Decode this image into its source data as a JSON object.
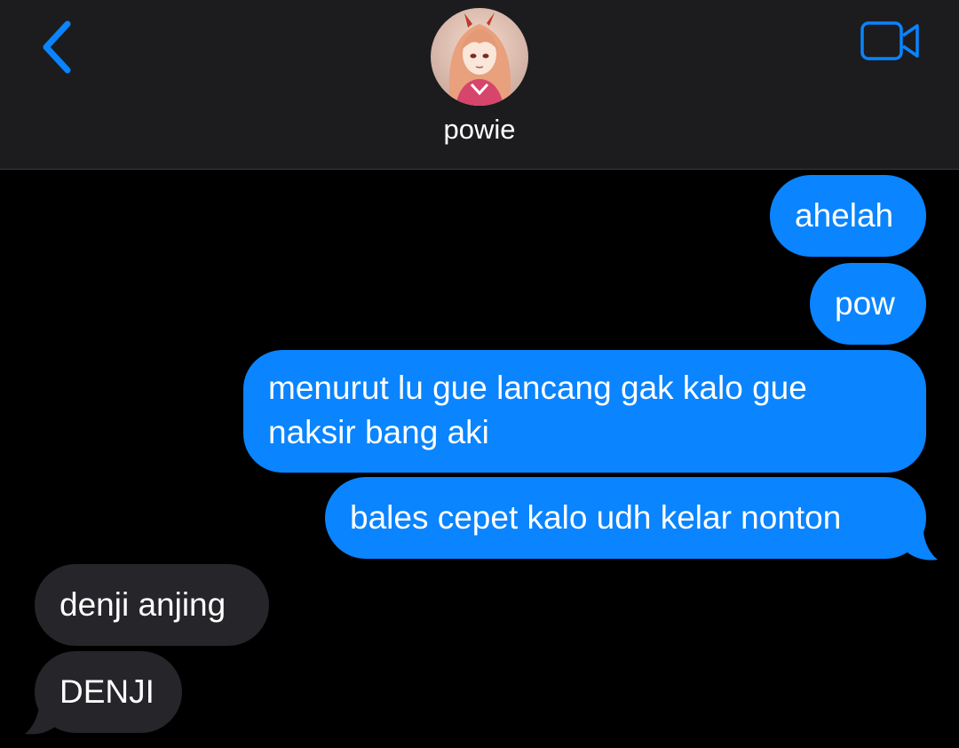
{
  "header": {
    "contact_name": "powie",
    "accent_color": "#0a84ff",
    "back_icon": "chevron-left-icon",
    "video_icon": "video-camera-icon"
  },
  "messages": [
    {
      "direction": "sent",
      "text": "ahelah"
    },
    {
      "direction": "sent",
      "text": "pow"
    },
    {
      "direction": "sent",
      "lines": [
        "menurut lu gue lancang gak kalo gue",
        "naksir bang aki"
      ]
    },
    {
      "direction": "sent",
      "text": "bales cepet kalo udh kelar nonton"
    },
    {
      "direction": "received",
      "text": "denji anjing"
    },
    {
      "direction": "received",
      "text": "DENJI"
    }
  ],
  "colors": {
    "sent_bubble": "#0a84ff",
    "received_bubble": "#26252a",
    "background": "#000000",
    "header_background": "#1c1c1e"
  }
}
